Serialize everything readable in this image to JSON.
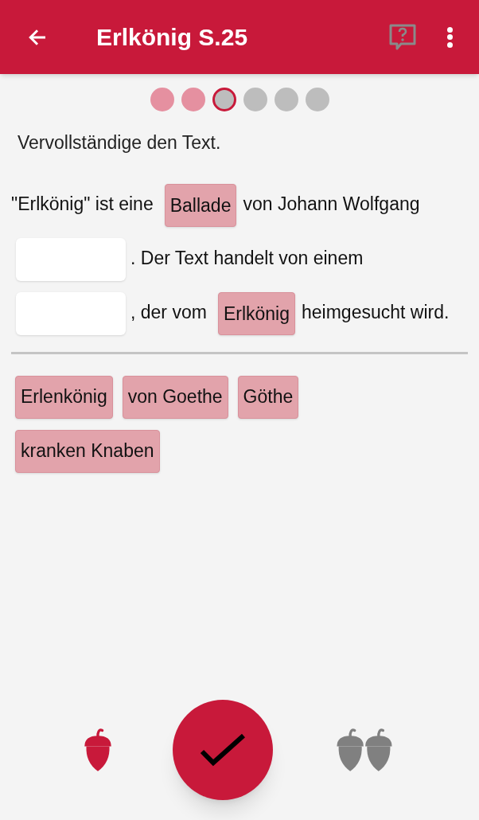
{
  "app_bar": {
    "title": "Erlkönig S.25"
  },
  "progress": [
    {
      "kind": "done"
    },
    {
      "kind": "done"
    },
    {
      "kind": "current"
    },
    {
      "kind": "todo"
    },
    {
      "kind": "todo"
    },
    {
      "kind": "todo"
    }
  ],
  "instruction": "Vervollständige den Text.",
  "passage": [
    {
      "kind": "text",
      "text": "\"Erlkönig\" ist eine"
    },
    {
      "kind": "chip",
      "text": "Ballade"
    },
    {
      "kind": "text",
      "text": "von Johann Wolfgang"
    },
    {
      "kind": "blank"
    },
    {
      "kind": "text",
      "text": ". Der Text handelt von einem"
    },
    {
      "kind": "blank"
    },
    {
      "kind": "text",
      "text": ", der vom"
    },
    {
      "kind": "chip",
      "text": "Erlkönig"
    },
    {
      "kind": "text",
      "text": "heimgesucht wird."
    }
  ],
  "options": [
    "Erlenkönig",
    "von Goethe",
    "Göthe",
    "kranken Knaben"
  ],
  "bottom_bar": {
    "single_hint": {
      "available": true
    },
    "double_hint": {
      "available": false
    }
  }
}
